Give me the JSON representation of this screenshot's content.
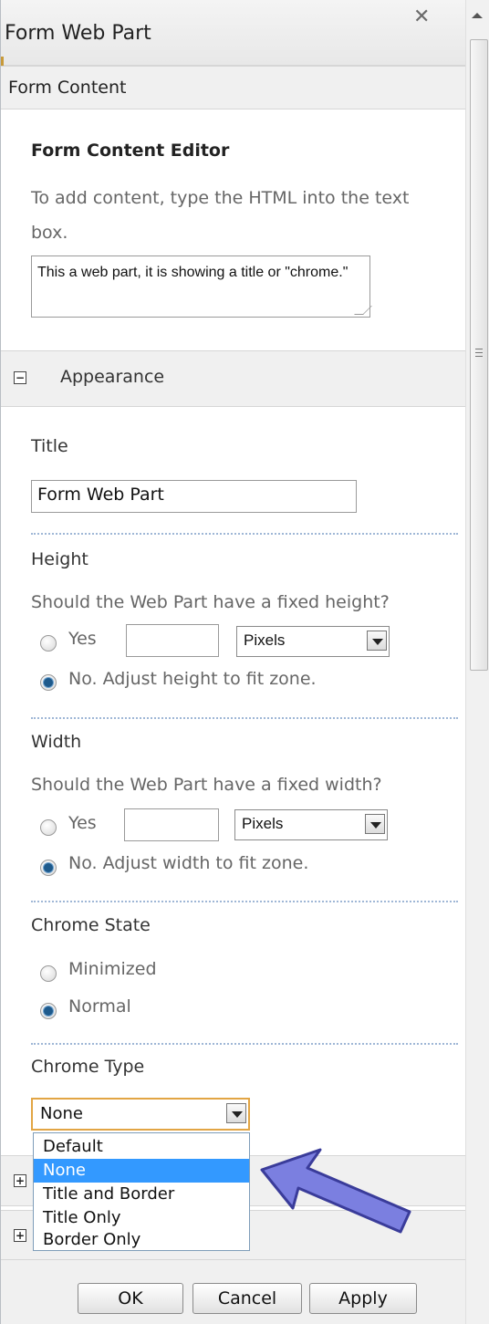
{
  "window": {
    "title": "Form Web Part",
    "close_glyph": "✕"
  },
  "form_content": {
    "section_label": "Form Content",
    "editor_title": "Form Content Editor",
    "description": "To add content, type the HTML into the text box.",
    "html_value": "This a web part, it is showing a title or \"chrome.\""
  },
  "appearance": {
    "section_label": "Appearance",
    "toggle": "−",
    "title_label": "Title",
    "title_value": "Form Web Part",
    "height": {
      "label": "Height",
      "question": "Should the Web Part have a fixed height?",
      "yes_label": "Yes",
      "yes_value": "",
      "unit": "Pixels",
      "no_label": "No. Adjust height to fit zone.",
      "selected": "no"
    },
    "width": {
      "label": "Width",
      "question": "Should the Web Part have a fixed width?",
      "yes_label": "Yes",
      "yes_value": "",
      "unit": "Pixels",
      "no_label": "No. Adjust width to fit zone.",
      "selected": "no"
    },
    "chrome_state": {
      "label": "Chrome State",
      "options": [
        "Minimized",
        "Normal"
      ],
      "selected": "Normal"
    },
    "chrome_type": {
      "label": "Chrome Type",
      "value": "None",
      "options": [
        "Default",
        "None",
        "Title and Border",
        "Title Only",
        "Border Only"
      ],
      "highlighted": "None"
    }
  },
  "collapsed_sections": {
    "toggle": "+"
  },
  "buttons": {
    "ok": "OK",
    "cancel": "Cancel",
    "apply": "Apply"
  },
  "annotation": {
    "arrow_color": "#7b7fe0",
    "pointing_to": "None"
  },
  "colors": {
    "highlight": "#3399ff",
    "focus_border": "#e2a544",
    "radio_selected": "#1e5a8c"
  }
}
